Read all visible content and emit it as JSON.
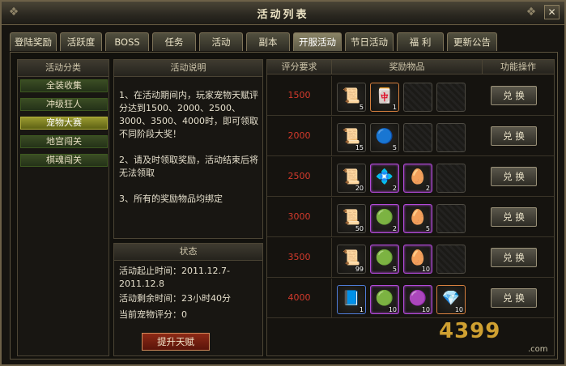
{
  "window": {
    "title": "活动列表",
    "close_label": "✕"
  },
  "tabs": [
    {
      "label": "登陆奖励",
      "active": false
    },
    {
      "label": "活跃度",
      "active": false
    },
    {
      "label": "BOSS",
      "active": false
    },
    {
      "label": "任务",
      "active": false
    },
    {
      "label": "活动",
      "active": false
    },
    {
      "label": "副本",
      "active": false
    },
    {
      "label": "开服活动",
      "active": true
    },
    {
      "label": "节日活动",
      "active": false
    },
    {
      "label": "福 利",
      "active": false
    },
    {
      "label": "更新公告",
      "active": false
    }
  ],
  "categories": {
    "header": "活动分类",
    "items": [
      {
        "label": "全装收集",
        "active": false
      },
      {
        "label": "冲级狂人",
        "active": false
      },
      {
        "label": "宠物大赛",
        "active": true
      },
      {
        "label": "地宫闯关",
        "active": false
      },
      {
        "label": "棋魂闯关",
        "active": false
      }
    ]
  },
  "description": {
    "header": "活动说明",
    "paragraphs": [
      "1、在活动期间内，玩家宠物天赋评分达到1500、2000、2500、3000、3500、4000时，即可领取不同阶段大奖！",
      "2、请及时领取奖励，活动结束后将无法领取",
      "3、所有的奖励物品均绑定"
    ]
  },
  "status": {
    "header": "状态",
    "start_time": "活动起止时间：2011.12.7-2011.12.8",
    "remaining": "活动剩余时间：23小时40分",
    "score": "当前宠物评分：0",
    "button": "提升天赋"
  },
  "table": {
    "headers": [
      "评分要求",
      "奖励物品",
      "功能操作"
    ],
    "redeem_label": "兑 换",
    "rows": [
      {
        "score": "1500",
        "items": [
          {
            "icon": "scroll-icon",
            "qty": "5",
            "frame": "plain"
          },
          {
            "icon": "talisman-icon",
            "qty": "1",
            "frame": "orange"
          },
          {
            "icon": "empty-slot",
            "qty": "",
            "frame": "empty"
          },
          {
            "icon": "empty-slot",
            "qty": "",
            "frame": "empty"
          }
        ]
      },
      {
        "score": "2000",
        "items": [
          {
            "icon": "scroll-icon",
            "qty": "15",
            "frame": "plain"
          },
          {
            "icon": "blue-orb-icon",
            "qty": "5",
            "frame": "plain"
          },
          {
            "icon": "empty-slot",
            "qty": "",
            "frame": "empty"
          },
          {
            "icon": "empty-slot",
            "qty": "",
            "frame": "empty"
          }
        ]
      },
      {
        "score": "2500",
        "items": [
          {
            "icon": "scroll-icon",
            "qty": "20",
            "frame": "plain"
          },
          {
            "icon": "purple-crystal-icon",
            "qty": "2",
            "frame": "purple"
          },
          {
            "icon": "pet-egg-icon",
            "qty": "2",
            "frame": "purple"
          },
          {
            "icon": "empty-slot",
            "qty": "",
            "frame": "empty"
          }
        ]
      },
      {
        "score": "3000",
        "items": [
          {
            "icon": "scroll-icon",
            "qty": "50",
            "frame": "plain"
          },
          {
            "icon": "green-orb-icon",
            "qty": "2",
            "frame": "purple"
          },
          {
            "icon": "pet-egg-icon",
            "qty": "5",
            "frame": "purple"
          },
          {
            "icon": "empty-slot",
            "qty": "",
            "frame": "empty"
          }
        ]
      },
      {
        "score": "3500",
        "items": [
          {
            "icon": "scroll-icon",
            "qty": "99",
            "frame": "plain"
          },
          {
            "icon": "green-orb-icon",
            "qty": "5",
            "frame": "purple"
          },
          {
            "icon": "pet-egg-icon",
            "qty": "10",
            "frame": "purple"
          },
          {
            "icon": "empty-slot",
            "qty": "",
            "frame": "empty"
          }
        ]
      },
      {
        "score": "4000",
        "items": [
          {
            "icon": "fire-tome-icon",
            "qty": "1",
            "frame": "blueb"
          },
          {
            "icon": "green-orb-icon",
            "qty": "10",
            "frame": "purple"
          },
          {
            "icon": "purple-orb-icon",
            "qty": "10",
            "frame": "purple"
          },
          {
            "icon": "red-gem-icon",
            "qty": "10",
            "frame": "orange"
          }
        ]
      }
    ]
  },
  "watermark": {
    "text": "4399",
    "suffix": ".com"
  },
  "colors": {
    "score_red": "#d33a2c",
    "active_category": "#9a9a30",
    "tab_active": "#8a8466"
  }
}
